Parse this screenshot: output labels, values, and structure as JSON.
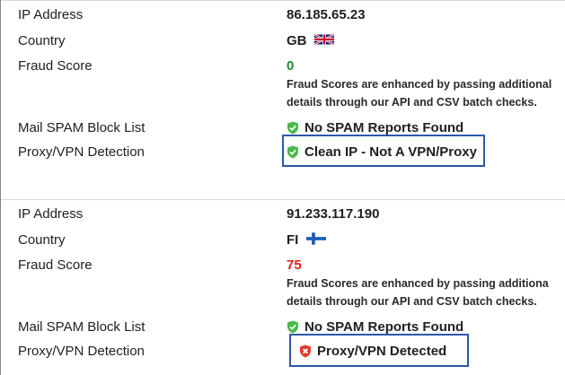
{
  "results": [
    {
      "ip_label": "IP Address",
      "ip": "86.185.65.23",
      "country_label": "Country",
      "country": "GB",
      "flag": "uk-flag-icon",
      "score_label": "Fraud Score",
      "score": "0",
      "score_color": "#1e8a2c",
      "note_line1": "Fraud Scores are enhanced by passing additional",
      "note_line2": "details through our API and CSV batch checks.",
      "spam_label": "Mail SPAM Block List",
      "spam_status": "No SPAM Reports Found",
      "spam_icon": "shield-check-icon",
      "proxy_label": "Proxy/VPN Detection",
      "proxy_status": "Clean IP - Not A VPN/Proxy",
      "proxy_icon": "shield-check-icon"
    },
    {
      "ip_label": "IP Address",
      "ip": "91.233.117.190",
      "country_label": "Country",
      "country": "FI",
      "flag": "finland-flag-icon",
      "score_label": "Fraud Score",
      "score": "75",
      "score_color": "#e0201b",
      "note_line1": "Fraud Scores are enhanced by passing additiona",
      "note_line2": "details through our API and CSV batch checks.",
      "spam_label": "Mail SPAM Block List",
      "spam_status": "No SPAM Reports Found",
      "spam_icon": "shield-check-icon",
      "proxy_label": "Proxy/VPN Detection",
      "proxy_status": "Proxy/VPN Detected",
      "proxy_icon": "shield-x-icon"
    }
  ],
  "colors": {
    "good": "#1e8a2c",
    "bad": "#e0201b",
    "highlight_border": "#2f57a6"
  }
}
